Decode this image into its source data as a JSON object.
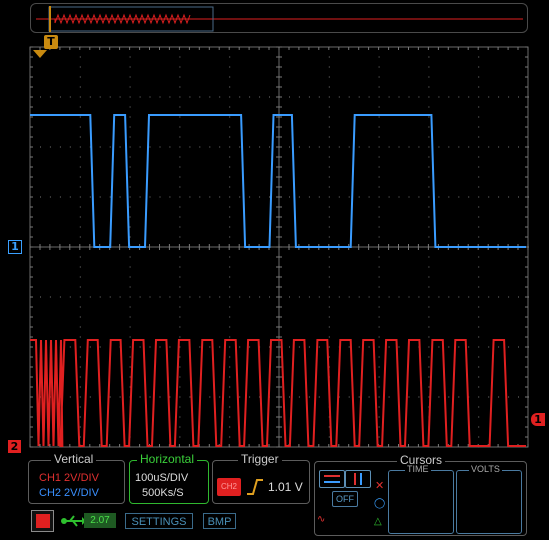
{
  "markers": {
    "trigger_time": "T",
    "ch1": "1",
    "ch2": "2",
    "trigger_level": "1"
  },
  "vertical": {
    "title": "Vertical",
    "ch1_scale": "CH1 2V/DIV",
    "ch2_scale": "CH2 2V/DIV"
  },
  "horizontal": {
    "title": "Horizontal",
    "time_div": "100uS/DIV",
    "sample_rate": "500Ks/S"
  },
  "trigger": {
    "title": "Trigger",
    "source": "CH2",
    "level": "1.01 V"
  },
  "cursors": {
    "title": "Cursors",
    "off_label": "OFF",
    "time_label": "TIME",
    "volts_label": "VOLTS"
  },
  "toolbar": {
    "version": "2.07",
    "settings_label": "SETTINGS",
    "bmp_label": "BMP"
  },
  "colors": {
    "ch1": "#3a9cff",
    "ch2": "#e02020",
    "grid": "#5a5a5a",
    "trigger_marker": "#c98a10"
  },
  "icons": [
    "stop-icon",
    "usb-icon",
    "rising-edge-icon"
  ],
  "waveforms": {
    "ch1_transitions_div": [
      0,
      1.25,
      1.65,
      1.95,
      2.35,
      4.28,
      4.85,
      5.3,
      6.48,
      8.1,
      10
    ],
    "ch1_start_high": true,
    "ch2_burst_end_div": 0.65,
    "ch2_pulse_edges_div": [
      0.65,
      0.95,
      1.12,
      1.4,
      1.58,
      1.86,
      2.03,
      2.32,
      2.49,
      2.78,
      2.95,
      3.24,
      3.42,
      3.7,
      3.88,
      4.17,
      4.34,
      4.63,
      4.8,
      5.09,
      5.26,
      5.55,
      5.73,
      6.01,
      6.19,
      6.48,
      6.65,
      6.94,
      7.11,
      7.4,
      7.57,
      7.86,
      8.04,
      8.33,
      8.5,
      8.79,
      9.27,
      9.56
    ]
  }
}
